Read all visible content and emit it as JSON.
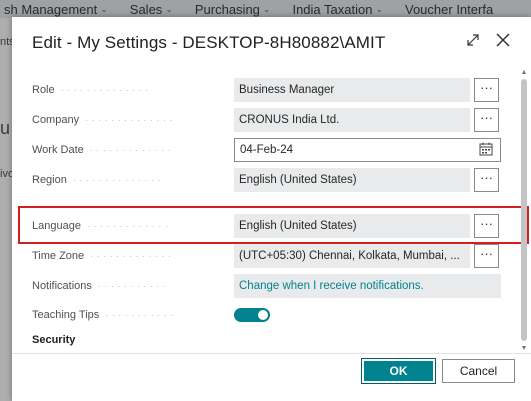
{
  "background": {
    "nav_items": [
      {
        "label": "sh Management"
      },
      {
        "label": "Sales"
      },
      {
        "label": "Purchasing"
      },
      {
        "label": "India Taxation"
      },
      {
        "label": "Voucher Interfa"
      }
    ],
    "side_fragments": [
      "nts",
      "u",
      "ivo"
    ]
  },
  "dialog": {
    "title": "Edit - My Settings - DESKTOP-8H80882\\AMIT",
    "expand_icon": "expand-icon",
    "close_icon": "close-icon",
    "fields": {
      "role": {
        "label": "Role",
        "value": "Business Manager"
      },
      "company": {
        "label": "Company",
        "value": "CRONUS India Ltd."
      },
      "work_date": {
        "label": "Work Date",
        "value": "04-Feb-24"
      },
      "region": {
        "label": "Region",
        "value": "English (United States)"
      },
      "language": {
        "label": "Language",
        "value": "English (United States)"
      },
      "time_zone": {
        "label": "Time Zone",
        "value": "(UTC+05:30) Chennai, Kolkata, Mumbai, ..."
      },
      "notifications": {
        "label": "Notifications",
        "value": "Change when I receive notifications."
      },
      "teaching_tips": {
        "label": "Teaching Tips",
        "enabled": true
      }
    },
    "lookup_glyph": "···",
    "section_security": "Security",
    "buttons": {
      "ok": "OK",
      "cancel": "Cancel"
    },
    "accent_color": "#00838f",
    "highlight_color": "#d21f1f"
  }
}
